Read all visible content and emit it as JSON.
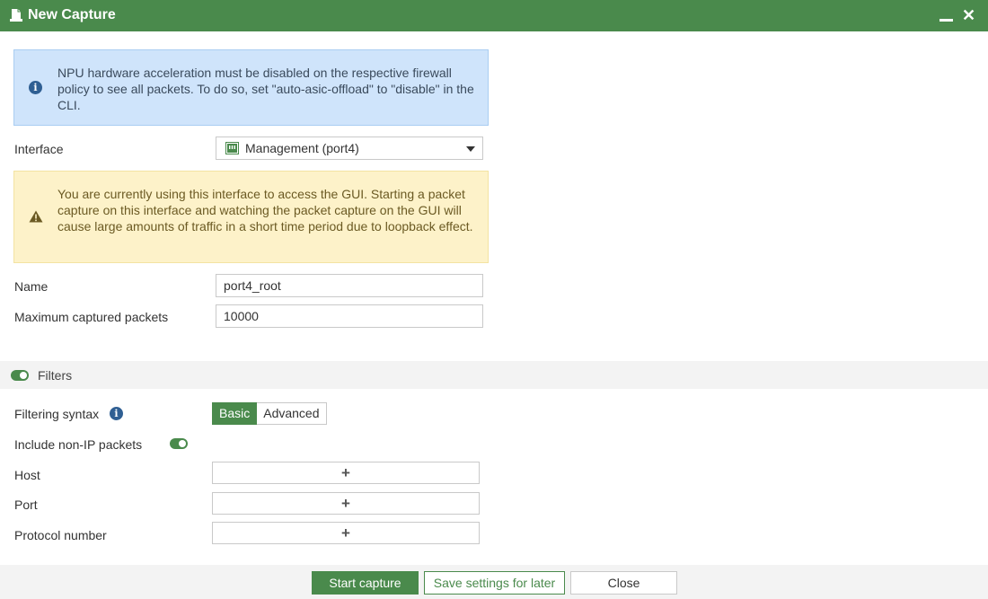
{
  "window": {
    "title": "New Capture",
    "minimize_glyph": "",
    "close_glyph": "✕"
  },
  "info_notice": {
    "text": "NPU hardware acceleration must be disabled on the respective firewall policy to see all packets. To do so, set \"auto-asic-offload\" to \"disable\" in the CLI.",
    "icon": "info-circle-icon"
  },
  "interface": {
    "label": "Interface",
    "selected": "Management (port4)",
    "icon": "network-port-icon"
  },
  "warning_notice": {
    "text": "You are currently using this interface to access the GUI. Starting a packet capture on this interface and watching the packet capture on the GUI will cause large amounts of traffic in a short time period due to loopback effect.",
    "icon": "warning-triangle-icon"
  },
  "name": {
    "label": "Name",
    "value": "port4_root"
  },
  "max_packets": {
    "label": "Maximum captured packets",
    "value": "10000"
  },
  "filters": {
    "title": "Filters",
    "enabled": true,
    "syntax_label": "Filtering syntax",
    "syntax_options": [
      "Basic",
      "Advanced"
    ],
    "syntax_selected": "Basic",
    "non_ip_label": "Include non-IP packets",
    "non_ip_enabled": true,
    "host_label": "Host",
    "port_label": "Port",
    "protocol_label": "Protocol number",
    "add_glyph": "+"
  },
  "footer": {
    "start_label": "Start capture",
    "save_label": "Save settings for later",
    "close_label": "Close"
  },
  "colors": {
    "accent": "#4a8a4c",
    "info_bg": "#cfe4fb",
    "warn_bg": "#fdf2c9"
  }
}
